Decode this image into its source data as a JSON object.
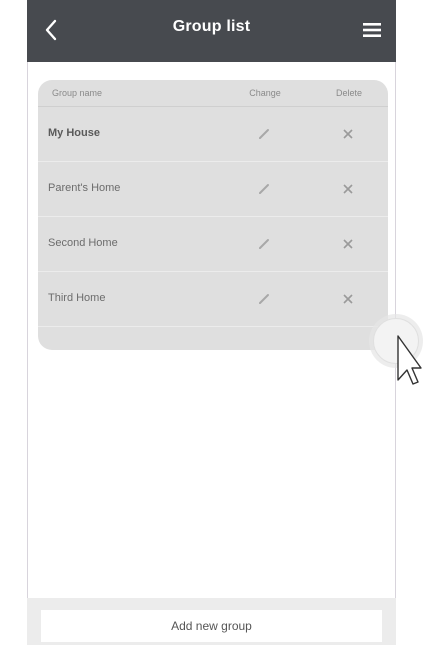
{
  "header": {
    "title": "Group list",
    "back_icon": "chevron-left-icon",
    "menu_icon": "hamburger-menu-icon"
  },
  "table": {
    "columns": {
      "name": "Group name",
      "change": "Change",
      "delete": "Delete"
    },
    "rows": [
      {
        "name": "My House"
      },
      {
        "name": "Parent's Home"
      },
      {
        "name": "Second Home"
      },
      {
        "name": "Third Home"
      }
    ]
  },
  "footer": {
    "add_label": "Add new group"
  },
  "colors": {
    "header_bg": "#474a4f",
    "card_bg": "#dfdfdf"
  }
}
